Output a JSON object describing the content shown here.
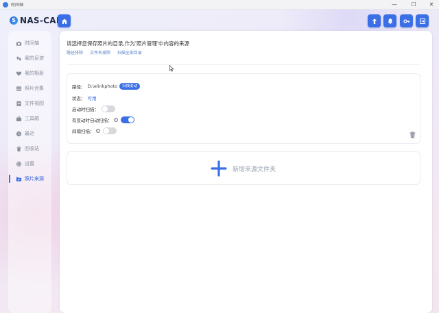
{
  "window": {
    "title": "时间轴",
    "buttons": {
      "minimize": "—",
      "maximize": "☐",
      "close": "✕"
    }
  },
  "brand": {
    "logo_text": "NAS-CAB",
    "logo_mark": "S"
  },
  "header": {
    "left_button_icon": "home-icon",
    "right_buttons": [
      "upload-icon",
      "bell-icon",
      "key-icon",
      "exit-icon"
    ]
  },
  "sidebar": {
    "items": [
      {
        "label": "时间轴",
        "icon": "camera-icon",
        "active": false
      },
      {
        "label": "我的足迹",
        "icon": "footprint-icon",
        "active": false
      },
      {
        "label": "我的相册",
        "icon": "heart-icon",
        "active": false
      },
      {
        "label": "照片合集",
        "icon": "collection-icon",
        "active": false
      },
      {
        "label": "文件视图",
        "icon": "folder-icon",
        "active": false
      },
      {
        "label": "工具箱",
        "icon": "toolbox-icon",
        "active": false
      },
      {
        "label": "最近",
        "icon": "clock-icon",
        "active": false
      },
      {
        "label": "回收站",
        "icon": "trash-icon",
        "active": false
      },
      {
        "label": "设置",
        "icon": "gear-icon",
        "active": false
      },
      {
        "label": "照片来源",
        "icon": "photo-source-icon",
        "active": true
      }
    ]
  },
  "main": {
    "intro": "请选择您保存照片的目录,作为'照片管理'中内容的来源",
    "links": [
      "路径排除",
      "文件名排除",
      "扫描全部目录"
    ],
    "source": {
      "path_label": "路径：",
      "path_value": "D:\\elinkphoto",
      "scan_change_badge": "扫描变动",
      "status_label": "状态：",
      "status_value": "可用",
      "startup_scan_label": "启动时扫描：",
      "startup_scan_on": false,
      "auto_scan_label": "有变动时自动扫描：",
      "auto_scan_on": true,
      "interval_scan_label": "间隔扫描：",
      "interval_scan_on": false,
      "help_glyph": "?"
    },
    "add_folder_label": "新增来源文件夹"
  },
  "colors": {
    "accent": "#3b6fe6",
    "link": "#5c82c8"
  }
}
